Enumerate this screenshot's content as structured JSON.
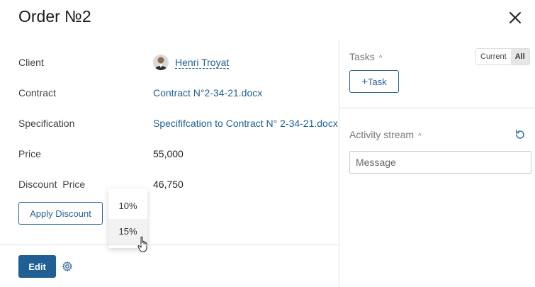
{
  "title": "Order №2",
  "fields": {
    "client": {
      "label": "Client",
      "value": "Henri Troyat"
    },
    "contract": {
      "label": "Contract",
      "value": "Contract N°2-34-21.docx"
    },
    "specification": {
      "label": "Specification",
      "value": "Specififcation to Contract N° 2-34-21.docx"
    },
    "price": {
      "label": "Price",
      "value": "55,000"
    },
    "discount_price": {
      "label": "Discount  Price",
      "value": "46,750"
    }
  },
  "buttons": {
    "apply_discount": "Apply Discount",
    "edit": "Edit",
    "task": "Task"
  },
  "dropdown": {
    "options": [
      "10%",
      "15%"
    ],
    "hovered": "15%"
  },
  "tasks": {
    "header": "Tasks",
    "filter": [
      "Current",
      "All"
    ],
    "active_filter": "All"
  },
  "activity": {
    "header": "Activity stream",
    "message_placeholder": "Message"
  },
  "colors": {
    "accent": "#1f5f93",
    "divider": "#e3e3e3"
  },
  "icons": [
    "close-icon",
    "avatar",
    "gear-icon",
    "refresh-icon",
    "plus-icon",
    "caret-up-icon",
    "hand-cursor-icon"
  ]
}
